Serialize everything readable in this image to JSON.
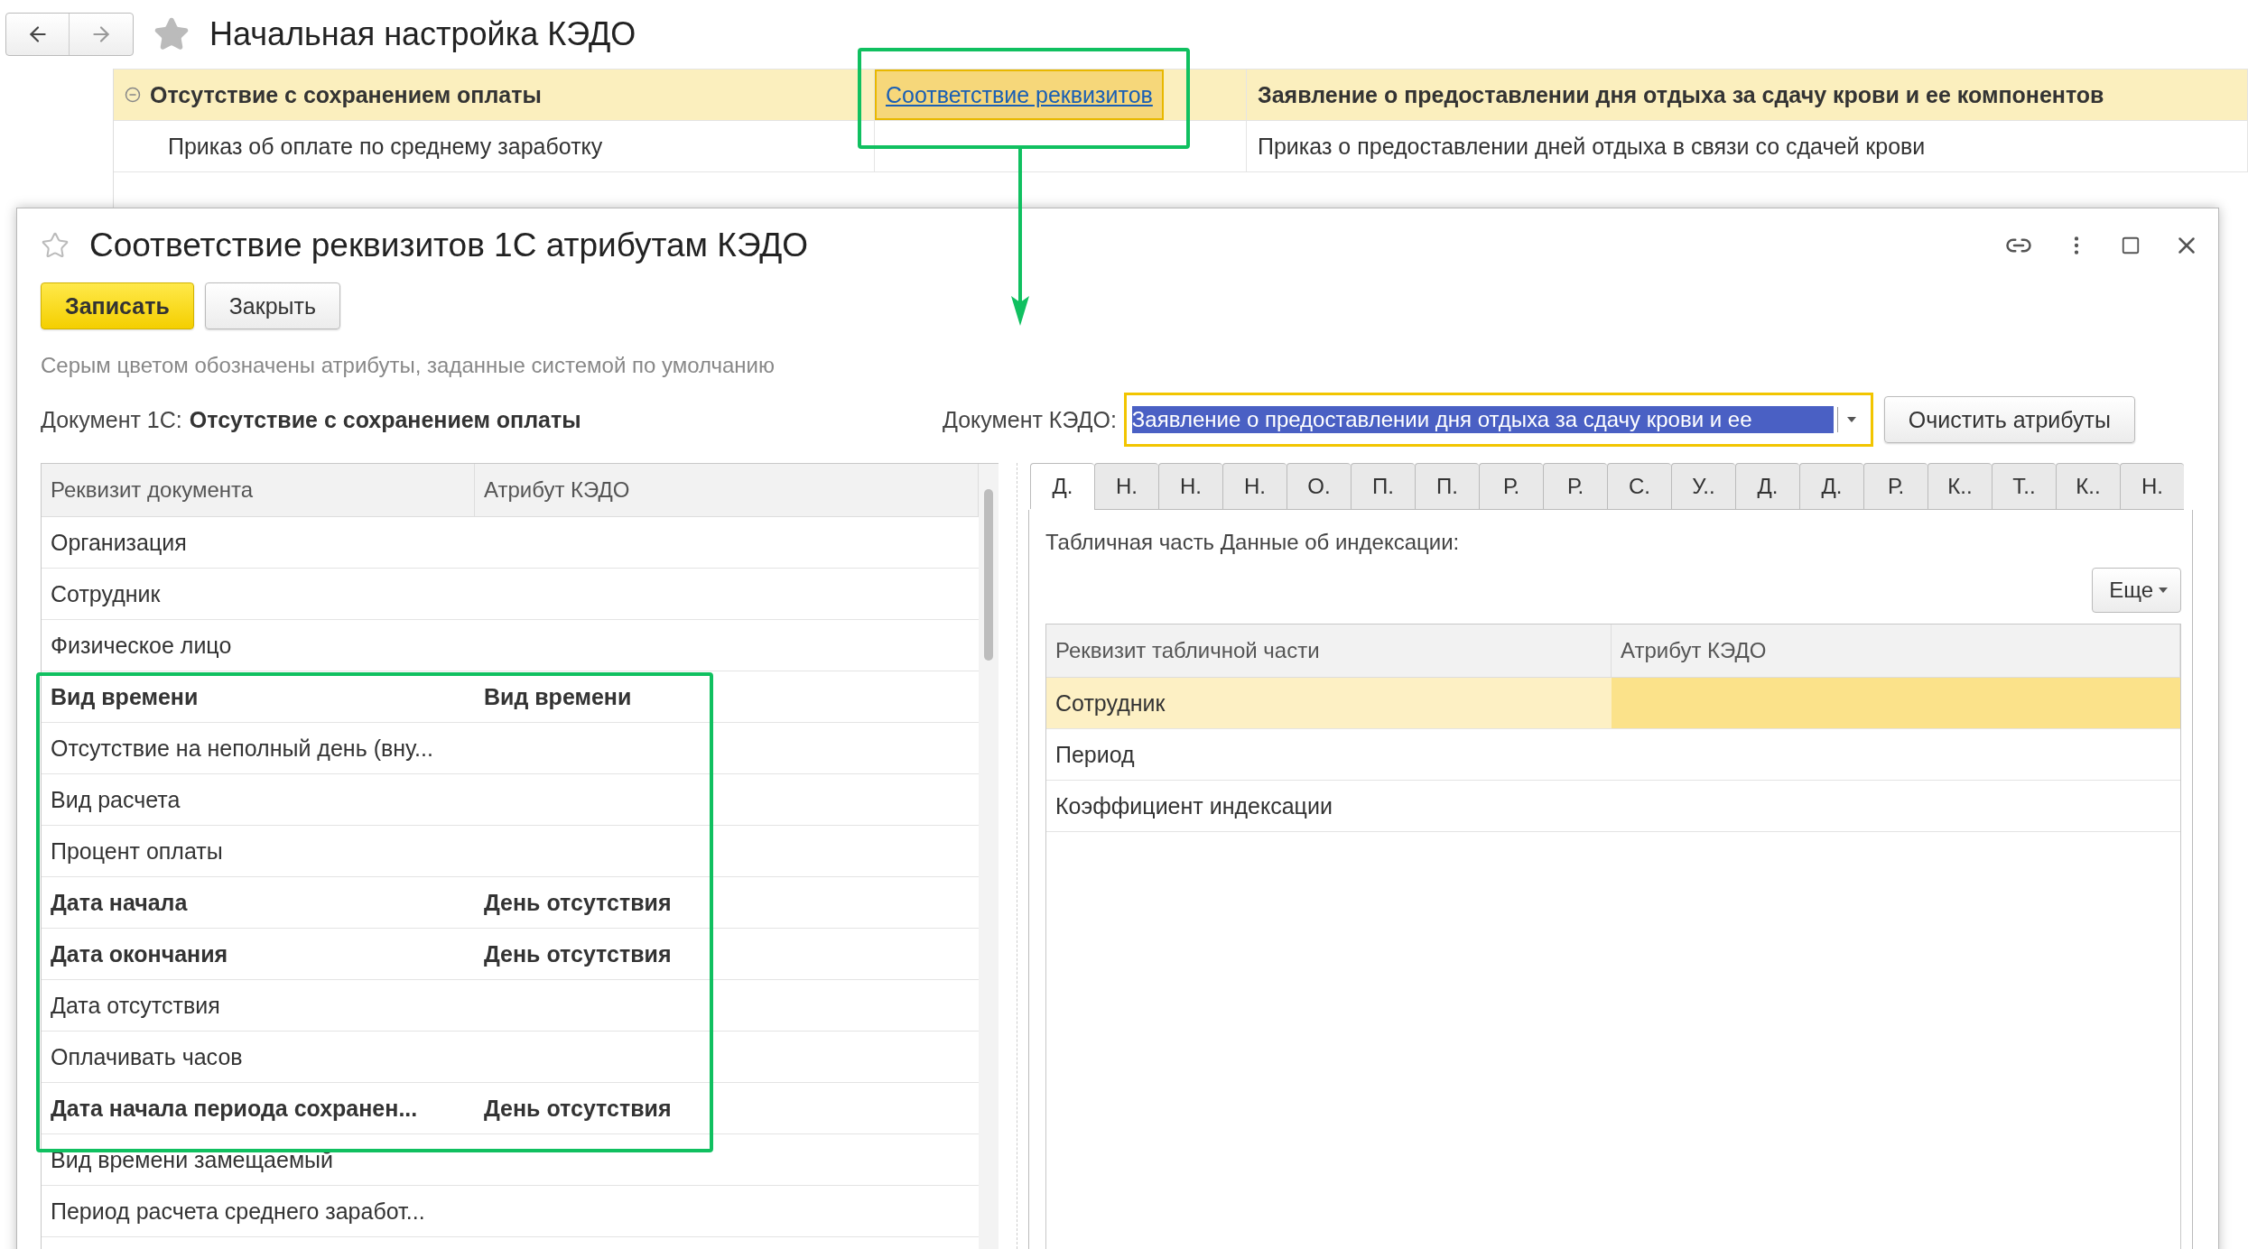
{
  "header": {
    "title": "Начальная настройка КЭДО"
  },
  "background_table": {
    "rows": [
      {
        "expanded": true,
        "selected": true,
        "cells": [
          "Отсутствие с сохранением оплаты",
          "Соответствие реквизитов",
          "Заявление о предоставлении дня отдыха за сдачу крови и ее компонентов"
        ]
      },
      {
        "expanded": false,
        "selected": false,
        "cells": [
          "Приказ об оплате по среднему заработку",
          "",
          "Приказ о предоставлении дней отдыха в связи со сдачей крови"
        ]
      }
    ]
  },
  "dialog": {
    "title": "Соответствие реквизитов 1С атрибутам КЭДО",
    "buttons": [
      {
        "label": "Записать",
        "kind": "primary"
      },
      {
        "label": "Закрыть",
        "kind": "default"
      }
    ],
    "hint": "Серым цветом обозначены атрибуты, заданные системой по умолчанию",
    "doc_1c_label": "Документ 1С:",
    "doc_1c_value": "Отсутствие с сохранением оплаты",
    "doc_kedo_label": "Документ КЭДО:",
    "doc_kedo_value": "Заявление о предоставлении дня отдыха за сдачу крови и ее",
    "clear_button": "Очистить атрибуты"
  },
  "left_table": {
    "columns": [
      "Реквизит документа",
      "Атрибут КЭДО"
    ],
    "rows": [
      {
        "bold": false,
        "cells": [
          "Организация",
          ""
        ]
      },
      {
        "bold": false,
        "cells": [
          "Сотрудник",
          ""
        ]
      },
      {
        "bold": false,
        "cells": [
          "Физическое лицо",
          ""
        ]
      },
      {
        "bold": true,
        "cells": [
          "Вид времени",
          "Вид времени"
        ]
      },
      {
        "bold": false,
        "cells": [
          "Отсутствие на неполный день (вну...",
          ""
        ]
      },
      {
        "bold": false,
        "cells": [
          "Вид расчета",
          ""
        ]
      },
      {
        "bold": false,
        "cells": [
          "Процент оплаты",
          ""
        ]
      },
      {
        "bold": true,
        "cells": [
          "Дата начала",
          "День отсутствия"
        ]
      },
      {
        "bold": true,
        "cells": [
          "Дата окончания",
          "День отсутствия"
        ]
      },
      {
        "bold": false,
        "cells": [
          "Дата отсутствия",
          ""
        ]
      },
      {
        "bold": false,
        "cells": [
          "Оплачивать часов",
          ""
        ]
      },
      {
        "bold": true,
        "cells": [
          "Дата начала периода сохранен...",
          "День отсутствия"
        ]
      },
      {
        "bold": false,
        "cells": [
          "Вид времени замещаемый",
          ""
        ]
      },
      {
        "bold": false,
        "cells": [
          "Период расчета среднего заработ...",
          ""
        ]
      }
    ]
  },
  "tabs": [
    {
      "label": "Д.",
      "selected": true
    },
    {
      "label": "Н.",
      "selected": false
    },
    {
      "label": "Н.",
      "selected": false
    },
    {
      "label": "Н.",
      "selected": false
    },
    {
      "label": "О.",
      "selected": false
    },
    {
      "label": "П.",
      "selected": false
    },
    {
      "label": "П.",
      "selected": false
    },
    {
      "label": "Р.",
      "selected": false
    },
    {
      "label": "Р.",
      "selected": false
    },
    {
      "label": "С.",
      "selected": false
    },
    {
      "label": "У..",
      "selected": false
    },
    {
      "label": "Д.",
      "selected": false
    },
    {
      "label": "Д.",
      "selected": false
    },
    {
      "label": "Р.",
      "selected": false
    },
    {
      "label": "К..",
      "selected": false
    },
    {
      "label": "Т..",
      "selected": false
    },
    {
      "label": "К..",
      "selected": false
    },
    {
      "label": "Н.",
      "selected": false
    }
  ],
  "panel": {
    "caption": "Табличная часть Данные об индексации:",
    "more_button": "Еще",
    "table": {
      "columns": [
        "Реквизит табличной части",
        "Атрибут КЭДО"
      ],
      "rows": [
        {
          "selected": true,
          "cells": [
            "Сотрудник",
            ""
          ]
        },
        {
          "selected": false,
          "cells": [
            "Период",
            ""
          ]
        },
        {
          "selected": false,
          "cells": [
            "Коэффициент индексации",
            ""
          ]
        }
      ]
    }
  }
}
